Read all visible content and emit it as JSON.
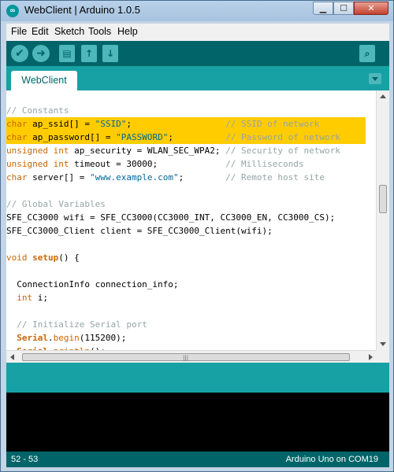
{
  "window": {
    "title": "WebClient | Arduino 1.0.5",
    "app_icon": "arduino-logo-icon",
    "minimize": "▁",
    "maximize": "☐",
    "close": "✕"
  },
  "menu": [
    "File",
    "Edit",
    "Sketch",
    "Tools",
    "Help"
  ],
  "toolbar": {
    "verify": "✔",
    "upload": "➜",
    "new": "▤",
    "open": "↑",
    "save": "↓",
    "serial_monitor": "⌕"
  },
  "tabs": [
    {
      "label": "WebClient"
    }
  ],
  "editor": {
    "lines": [
      {
        "text": "",
        "highlight": false,
        "tokens": []
      },
      {
        "highlight": false,
        "tokens": [
          [
            "comment",
            "// Constants"
          ]
        ]
      },
      {
        "highlight": true,
        "tokens": [
          [
            "kw",
            "char"
          ],
          [
            "plain",
            " ap_ssid[] = "
          ],
          [
            "str",
            "\"SSID\""
          ],
          [
            "plain",
            ";                  "
          ],
          [
            "comment",
            "// SSID of network"
          ]
        ]
      },
      {
        "highlight": true,
        "tokens": [
          [
            "kw",
            "char"
          ],
          [
            "plain",
            " ap_password[] = "
          ],
          [
            "str",
            "\"PASSWORD\""
          ],
          [
            "plain",
            ";          "
          ],
          [
            "comment",
            "// Password of network"
          ]
        ]
      },
      {
        "highlight": false,
        "tokens": [
          [
            "kw",
            "unsigned int"
          ],
          [
            "plain",
            " ap_security = WLAN_SEC_WPA2; "
          ],
          [
            "comment",
            "// Security of network"
          ]
        ]
      },
      {
        "highlight": false,
        "tokens": [
          [
            "kw",
            "unsigned int"
          ],
          [
            "plain",
            " timeout = 30000;             "
          ],
          [
            "comment",
            "// Milliseconds"
          ]
        ]
      },
      {
        "highlight": false,
        "tokens": [
          [
            "kw",
            "char"
          ],
          [
            "plain",
            " server[] = "
          ],
          [
            "str",
            "\"www.example.com\""
          ],
          [
            "plain",
            ";        "
          ],
          [
            "comment",
            "// Remote host site"
          ]
        ]
      },
      {
        "highlight": false,
        "tokens": []
      },
      {
        "highlight": false,
        "tokens": [
          [
            "comment",
            "// Global Variables"
          ]
        ]
      },
      {
        "highlight": false,
        "tokens": [
          [
            "plain",
            "SFE_CC3000 wifi = SFE_CC3000(CC3000_INT, CC3000_EN, CC3000_CS);"
          ]
        ]
      },
      {
        "highlight": false,
        "tokens": [
          [
            "plain",
            "SFE_CC3000_Client client = SFE_CC3000_Client(wifi);"
          ]
        ]
      },
      {
        "highlight": false,
        "tokens": []
      },
      {
        "highlight": false,
        "tokens": [
          [
            "kw",
            "void"
          ],
          [
            "plain",
            " "
          ],
          [
            "fn",
            "setup"
          ],
          [
            "plain",
            "() {"
          ]
        ]
      },
      {
        "highlight": false,
        "tokens": []
      },
      {
        "highlight": false,
        "tokens": [
          [
            "plain",
            "  ConnectionInfo connection_info;"
          ]
        ]
      },
      {
        "highlight": false,
        "tokens": [
          [
            "plain",
            "  "
          ],
          [
            "kw",
            "int"
          ],
          [
            "plain",
            " i;"
          ]
        ]
      },
      {
        "highlight": false,
        "tokens": []
      },
      {
        "highlight": false,
        "tokens": [
          [
            "plain",
            "  "
          ],
          [
            "comment",
            "// Initialize Serial port"
          ]
        ]
      },
      {
        "highlight": false,
        "tokens": [
          [
            "plain",
            "  "
          ],
          [
            "fn",
            "Serial"
          ],
          [
            "plain",
            "."
          ],
          [
            "kw",
            "begin"
          ],
          [
            "plain",
            "(115200);"
          ]
        ]
      },
      {
        "highlight": false,
        "tokens": [
          [
            "plain",
            "  "
          ],
          [
            "fn",
            "Serial"
          ],
          [
            "plain",
            "."
          ],
          [
            "kw",
            "println"
          ],
          [
            "plain",
            "();"
          ]
        ]
      }
    ]
  },
  "status": {
    "line_range": "52 - 53",
    "board": "Arduino Uno on COM19"
  },
  "colors": {
    "toolbar": "#006468",
    "accent": "#17a1a5",
    "highlight": "#ffcc00",
    "console": "#000000"
  }
}
